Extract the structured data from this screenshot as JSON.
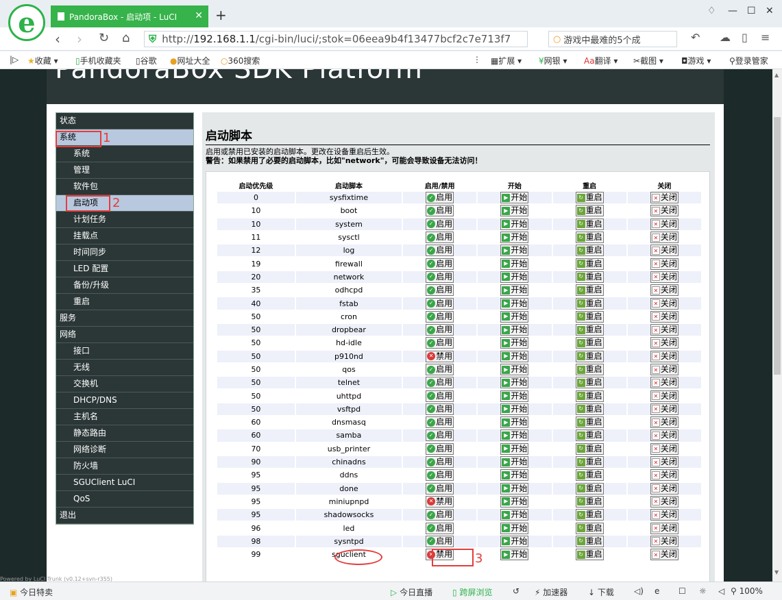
{
  "browser": {
    "tab_title": "PandoraBox - 启动项 - LuCI",
    "url_prefix": "http://",
    "url_host": "192.168.1.1",
    "url_path": "/cgi-bin/luci/;stok=06eea9b4f13477bcf2c7e713f7",
    "search_text": "游戏中最难的5个成",
    "bookmarks": [
      "收藏",
      "手机收藏夹",
      "谷歌",
      "网址大全",
      "360搜索"
    ],
    "extensions": [
      "扩展",
      "网银",
      "翻译",
      "截图",
      "游戏",
      "登录管家"
    ],
    "status_left": "今日特卖",
    "status_items": [
      "今日直播",
      "跨屏浏览",
      "加速器",
      "下载"
    ],
    "zoom": "100%"
  },
  "page": {
    "header": "PandoraBox SDK Platform",
    "powered": "Powered by LuCI Trunk (v0.12+svn-r355)"
  },
  "sidebar": {
    "items": [
      {
        "label": "状态",
        "level": 0
      },
      {
        "label": "系统",
        "level": 0,
        "active": true
      },
      {
        "label": "系统",
        "level": 1
      },
      {
        "label": "管理",
        "level": 1
      },
      {
        "label": "软件包",
        "level": 1
      },
      {
        "label": "启动项",
        "level": 1,
        "active": true
      },
      {
        "label": "计划任务",
        "level": 1
      },
      {
        "label": "挂载点",
        "level": 1
      },
      {
        "label": "时间同步",
        "level": 1
      },
      {
        "label": "LED 配置",
        "level": 1
      },
      {
        "label": "备份/升级",
        "level": 1
      },
      {
        "label": "重启",
        "level": 1
      },
      {
        "label": "服务",
        "level": 0
      },
      {
        "label": "网络",
        "level": 0
      },
      {
        "label": "接口",
        "level": 1
      },
      {
        "label": "无线",
        "level": 1
      },
      {
        "label": "交换机",
        "level": 1
      },
      {
        "label": "DHCP/DNS",
        "level": 1
      },
      {
        "label": "主机名",
        "level": 1
      },
      {
        "label": "静态路由",
        "level": 1
      },
      {
        "label": "网络诊断",
        "level": 1
      },
      {
        "label": "防火墙",
        "level": 1
      },
      {
        "label": "SGUClient LuCI",
        "level": 1
      },
      {
        "label": "QoS",
        "level": 1
      },
      {
        "label": "退出",
        "level": 0
      }
    ]
  },
  "main": {
    "title": "启动脚本",
    "description": "启用或禁用已安装的启动脚本。更改在设备重启后生效。",
    "warning": "警告：如果禁用了必要的启动脚本，比如\"network\"，可能会导致设备无法访问！",
    "columns": [
      "启动优先级",
      "启动脚本",
      "启用/禁用",
      "开始",
      "重启",
      "关闭"
    ],
    "labels": {
      "enabled": "启用",
      "disabled": "禁用",
      "start": "开始",
      "restart": "重启",
      "stop": "关闭"
    },
    "rows": [
      {
        "priority": "0",
        "script": "sysfixtime",
        "enabled": true
      },
      {
        "priority": "10",
        "script": "boot",
        "enabled": true
      },
      {
        "priority": "10",
        "script": "system",
        "enabled": true
      },
      {
        "priority": "11",
        "script": "sysctl",
        "enabled": true
      },
      {
        "priority": "12",
        "script": "log",
        "enabled": true
      },
      {
        "priority": "19",
        "script": "firewall",
        "enabled": true
      },
      {
        "priority": "20",
        "script": "network",
        "enabled": true
      },
      {
        "priority": "35",
        "script": "odhcpd",
        "enabled": true
      },
      {
        "priority": "40",
        "script": "fstab",
        "enabled": true
      },
      {
        "priority": "50",
        "script": "cron",
        "enabled": true
      },
      {
        "priority": "50",
        "script": "dropbear",
        "enabled": true
      },
      {
        "priority": "50",
        "script": "hd-idle",
        "enabled": true
      },
      {
        "priority": "50",
        "script": "p910nd",
        "enabled": false
      },
      {
        "priority": "50",
        "script": "qos",
        "enabled": true
      },
      {
        "priority": "50",
        "script": "telnet",
        "enabled": true
      },
      {
        "priority": "50",
        "script": "uhttpd",
        "enabled": true
      },
      {
        "priority": "50",
        "script": "vsftpd",
        "enabled": true
      },
      {
        "priority": "60",
        "script": "dnsmasq",
        "enabled": true
      },
      {
        "priority": "60",
        "script": "samba",
        "enabled": true
      },
      {
        "priority": "70",
        "script": "usb_printer",
        "enabled": true
      },
      {
        "priority": "90",
        "script": "chinadns",
        "enabled": true
      },
      {
        "priority": "95",
        "script": "ddns",
        "enabled": true
      },
      {
        "priority": "95",
        "script": "done",
        "enabled": true
      },
      {
        "priority": "95",
        "script": "miniupnpd",
        "enabled": false
      },
      {
        "priority": "95",
        "script": "shadowsocks",
        "enabled": true
      },
      {
        "priority": "96",
        "script": "led",
        "enabled": true
      },
      {
        "priority": "98",
        "script": "sysntpd",
        "enabled": true
      },
      {
        "priority": "99",
        "script": "sguclient",
        "enabled": false
      }
    ]
  },
  "annotations": [
    "1",
    "2",
    "3"
  ],
  "colors": {
    "accent": "#e53c3c",
    "tab": "#36b34a",
    "sidebar": "#2b3636"
  }
}
